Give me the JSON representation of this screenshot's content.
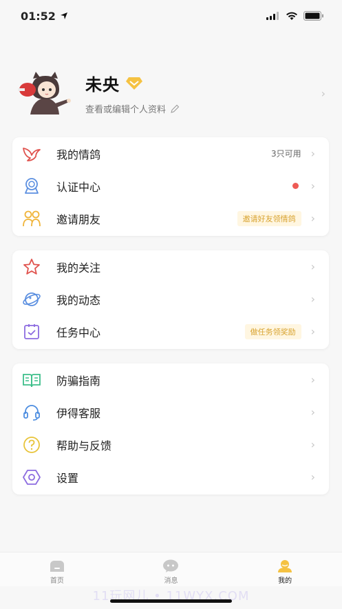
{
  "status_bar": {
    "time": "01:52"
  },
  "profile": {
    "name": "未央",
    "subtitle": "查看或编辑个人资料"
  },
  "sections": [
    {
      "items": [
        {
          "label": "我的情鸽",
          "meta": "3只可用"
        },
        {
          "label": "认证中心"
        },
        {
          "label": "邀请朋友",
          "badge": "邀请好友领情鸽"
        }
      ]
    },
    {
      "items": [
        {
          "label": "我的关注"
        },
        {
          "label": "我的动态"
        },
        {
          "label": "任务中心",
          "badge": "做任务领奖励"
        }
      ]
    },
    {
      "items": [
        {
          "label": "防骗指南"
        },
        {
          "label": "伊得客服"
        },
        {
          "label": "帮助与反馈"
        },
        {
          "label": "设置"
        }
      ]
    }
  ],
  "tabbar": {
    "tabs": [
      {
        "label": "首页",
        "icon": "home-icon"
      },
      {
        "label": "消息",
        "icon": "message-icon"
      },
      {
        "label": "我的",
        "icon": "profile-icon",
        "active": true
      }
    ]
  },
  "watermark": "11玩网儿 • 11WYX.COM",
  "colors": {
    "accent": "#f5c242",
    "red": "#ee5b55",
    "badge_text": "#d8a330"
  }
}
